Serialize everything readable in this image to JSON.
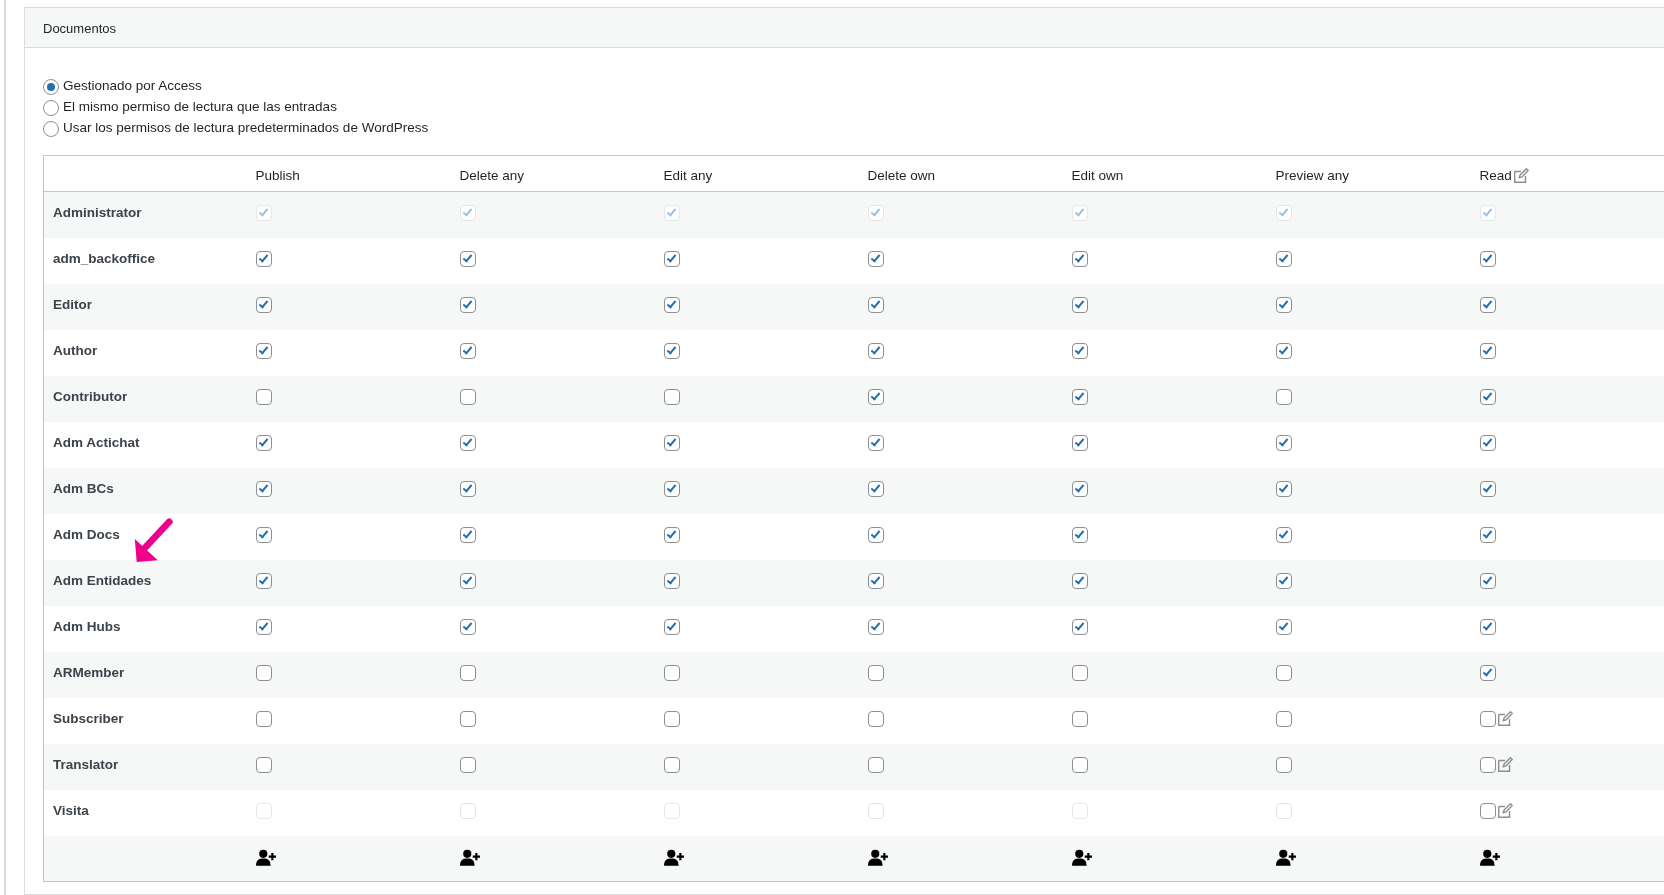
{
  "panel": {
    "title": "Documentos"
  },
  "options": [
    {
      "label": "Gestionado por Access",
      "selected": true
    },
    {
      "label": "El mismo permiso de lectura que las entradas",
      "selected": false
    },
    {
      "label": "Usar los permisos de lectura predeterminados de WordPress",
      "selected": false
    }
  ],
  "table": {
    "columns": [
      {
        "label": "Publish",
        "kind": "plain"
      },
      {
        "label": "Delete any",
        "kind": "plain"
      },
      {
        "label": "Edit any",
        "kind": "plain"
      },
      {
        "label": "Delete own",
        "kind": "plain"
      },
      {
        "label": "Edit own",
        "kind": "plain"
      },
      {
        "label": "Preview any",
        "kind": "plain"
      },
      {
        "label": "Read",
        "kind": "edit"
      }
    ],
    "rows": [
      {
        "role": "Administrator",
        "cells": [
          {
            "kind": "check",
            "checked": true,
            "disabled": true
          },
          {
            "kind": "check",
            "checked": true,
            "disabled": true
          },
          {
            "kind": "check",
            "checked": true,
            "disabled": true
          },
          {
            "kind": "check",
            "checked": true,
            "disabled": true
          },
          {
            "kind": "check",
            "checked": true,
            "disabled": true
          },
          {
            "kind": "check",
            "checked": true,
            "disabled": true
          },
          {
            "kind": "check",
            "checked": true,
            "disabled": true
          }
        ]
      },
      {
        "role": "adm_backoffice",
        "cells": [
          {
            "kind": "check",
            "checked": true,
            "disabled": false
          },
          {
            "kind": "check",
            "checked": true,
            "disabled": false
          },
          {
            "kind": "check",
            "checked": true,
            "disabled": false
          },
          {
            "kind": "check",
            "checked": true,
            "disabled": false
          },
          {
            "kind": "check",
            "checked": true,
            "disabled": false
          },
          {
            "kind": "check",
            "checked": true,
            "disabled": false
          },
          {
            "kind": "check",
            "checked": true,
            "disabled": false
          }
        ]
      },
      {
        "role": "Editor",
        "cells": [
          {
            "kind": "check",
            "checked": true,
            "disabled": false
          },
          {
            "kind": "check",
            "checked": true,
            "disabled": false
          },
          {
            "kind": "check",
            "checked": true,
            "disabled": false
          },
          {
            "kind": "check",
            "checked": true,
            "disabled": false
          },
          {
            "kind": "check",
            "checked": true,
            "disabled": false
          },
          {
            "kind": "check",
            "checked": true,
            "disabled": false
          },
          {
            "kind": "check",
            "checked": true,
            "disabled": false
          }
        ]
      },
      {
        "role": "Author",
        "cells": [
          {
            "kind": "check",
            "checked": true,
            "disabled": false
          },
          {
            "kind": "check",
            "checked": true,
            "disabled": false
          },
          {
            "kind": "check",
            "checked": true,
            "disabled": false
          },
          {
            "kind": "check",
            "checked": true,
            "disabled": false
          },
          {
            "kind": "check",
            "checked": true,
            "disabled": false
          },
          {
            "kind": "check",
            "checked": true,
            "disabled": false
          },
          {
            "kind": "check",
            "checked": true,
            "disabled": false
          }
        ]
      },
      {
        "role": "Contributor",
        "cells": [
          {
            "kind": "check",
            "checked": false,
            "disabled": false
          },
          {
            "kind": "check",
            "checked": false,
            "disabled": false
          },
          {
            "kind": "check",
            "checked": false,
            "disabled": false
          },
          {
            "kind": "check",
            "checked": true,
            "disabled": false
          },
          {
            "kind": "check",
            "checked": true,
            "disabled": false
          },
          {
            "kind": "check",
            "checked": false,
            "disabled": false
          },
          {
            "kind": "check",
            "checked": true,
            "disabled": false
          }
        ]
      },
      {
        "role": "Adm Actichat",
        "cells": [
          {
            "kind": "check",
            "checked": true,
            "disabled": false
          },
          {
            "kind": "check",
            "checked": true,
            "disabled": false
          },
          {
            "kind": "check",
            "checked": true,
            "disabled": false
          },
          {
            "kind": "check",
            "checked": true,
            "disabled": false
          },
          {
            "kind": "check",
            "checked": true,
            "disabled": false
          },
          {
            "kind": "check",
            "checked": true,
            "disabled": false
          },
          {
            "kind": "check",
            "checked": true,
            "disabled": false
          }
        ]
      },
      {
        "role": "Adm BCs",
        "cells": [
          {
            "kind": "check",
            "checked": true,
            "disabled": false
          },
          {
            "kind": "check",
            "checked": true,
            "disabled": false
          },
          {
            "kind": "check",
            "checked": true,
            "disabled": false
          },
          {
            "kind": "check",
            "checked": true,
            "disabled": false
          },
          {
            "kind": "check",
            "checked": true,
            "disabled": false
          },
          {
            "kind": "check",
            "checked": true,
            "disabled": false
          },
          {
            "kind": "check",
            "checked": true,
            "disabled": false
          }
        ]
      },
      {
        "role": "Adm Docs",
        "cells": [
          {
            "kind": "check",
            "checked": true,
            "disabled": false
          },
          {
            "kind": "check",
            "checked": true,
            "disabled": false
          },
          {
            "kind": "check",
            "checked": true,
            "disabled": false
          },
          {
            "kind": "check",
            "checked": true,
            "disabled": false
          },
          {
            "kind": "check",
            "checked": true,
            "disabled": false
          },
          {
            "kind": "check",
            "checked": true,
            "disabled": false
          },
          {
            "kind": "check",
            "checked": true,
            "disabled": false
          }
        ]
      },
      {
        "role": "Adm Entidades",
        "cells": [
          {
            "kind": "check",
            "checked": true,
            "disabled": false
          },
          {
            "kind": "check",
            "checked": true,
            "disabled": false
          },
          {
            "kind": "check",
            "checked": true,
            "disabled": false
          },
          {
            "kind": "check",
            "checked": true,
            "disabled": false
          },
          {
            "kind": "check",
            "checked": true,
            "disabled": false
          },
          {
            "kind": "check",
            "checked": true,
            "disabled": false
          },
          {
            "kind": "check",
            "checked": true,
            "disabled": false
          }
        ]
      },
      {
        "role": "Adm Hubs",
        "cells": [
          {
            "kind": "check",
            "checked": true,
            "disabled": false
          },
          {
            "kind": "check",
            "checked": true,
            "disabled": false
          },
          {
            "kind": "check",
            "checked": true,
            "disabled": false
          },
          {
            "kind": "check",
            "checked": true,
            "disabled": false
          },
          {
            "kind": "check",
            "checked": true,
            "disabled": false
          },
          {
            "kind": "check",
            "checked": true,
            "disabled": false
          },
          {
            "kind": "check",
            "checked": true,
            "disabled": false
          }
        ]
      },
      {
        "role": "ARMember",
        "cells": [
          {
            "kind": "check",
            "checked": false,
            "disabled": false
          },
          {
            "kind": "check",
            "checked": false,
            "disabled": false
          },
          {
            "kind": "check",
            "checked": false,
            "disabled": false
          },
          {
            "kind": "check",
            "checked": false,
            "disabled": false
          },
          {
            "kind": "check",
            "checked": false,
            "disabled": false
          },
          {
            "kind": "check",
            "checked": false,
            "disabled": false
          },
          {
            "kind": "check",
            "checked": true,
            "disabled": false
          }
        ]
      },
      {
        "role": "Subscriber",
        "cells": [
          {
            "kind": "check",
            "checked": false,
            "disabled": false
          },
          {
            "kind": "check",
            "checked": false,
            "disabled": false
          },
          {
            "kind": "check",
            "checked": false,
            "disabled": false
          },
          {
            "kind": "check",
            "checked": false,
            "disabled": false
          },
          {
            "kind": "check",
            "checked": false,
            "disabled": false
          },
          {
            "kind": "check",
            "checked": false,
            "disabled": false
          },
          {
            "kind": "check_edit",
            "checked": false,
            "disabled": false
          }
        ]
      },
      {
        "role": "Translator",
        "cells": [
          {
            "kind": "check",
            "checked": false,
            "disabled": false
          },
          {
            "kind": "check",
            "checked": false,
            "disabled": false
          },
          {
            "kind": "check",
            "checked": false,
            "disabled": false
          },
          {
            "kind": "check",
            "checked": false,
            "disabled": false
          },
          {
            "kind": "check",
            "checked": false,
            "disabled": false
          },
          {
            "kind": "check",
            "checked": false,
            "disabled": false
          },
          {
            "kind": "check_edit",
            "checked": false,
            "disabled": false
          }
        ]
      },
      {
        "role": "Visita",
        "cells": [
          {
            "kind": "check",
            "checked": false,
            "disabled": true
          },
          {
            "kind": "check",
            "checked": false,
            "disabled": true
          },
          {
            "kind": "check",
            "checked": false,
            "disabled": true
          },
          {
            "kind": "check",
            "checked": false,
            "disabled": true
          },
          {
            "kind": "check",
            "checked": false,
            "disabled": true
          },
          {
            "kind": "check",
            "checked": false,
            "disabled": true
          },
          {
            "kind": "check_edit",
            "checked": false,
            "disabled": false
          }
        ]
      }
    ]
  }
}
